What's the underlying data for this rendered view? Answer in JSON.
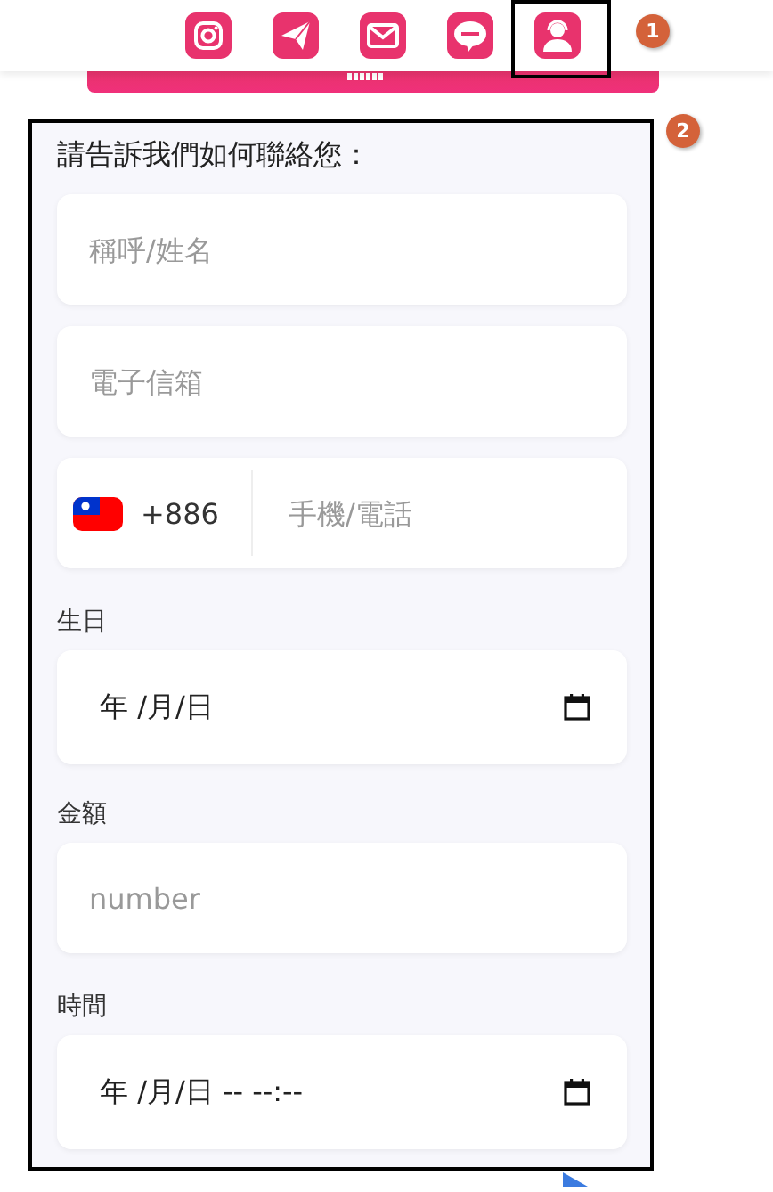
{
  "annotations": [
    {
      "number": "1"
    },
    {
      "number": "2"
    }
  ],
  "form": {
    "heading": "請告訴我們如何聯絡您：",
    "fields": [
      {
        "kind": "text",
        "placeholder": "稱呼/姓名"
      },
      {
        "kind": "text",
        "placeholder": "電子信箱"
      },
      {
        "kind": "phone",
        "country_code": "+886",
        "placeholder": "手機/電話"
      },
      {
        "kind": "date",
        "label": "生日",
        "value": "年 /月/日"
      },
      {
        "kind": "text",
        "label": "金額",
        "placeholder": "number"
      },
      {
        "kind": "date",
        "label": "時間",
        "value": "年 /月/日 -- --:--"
      }
    ]
  }
}
